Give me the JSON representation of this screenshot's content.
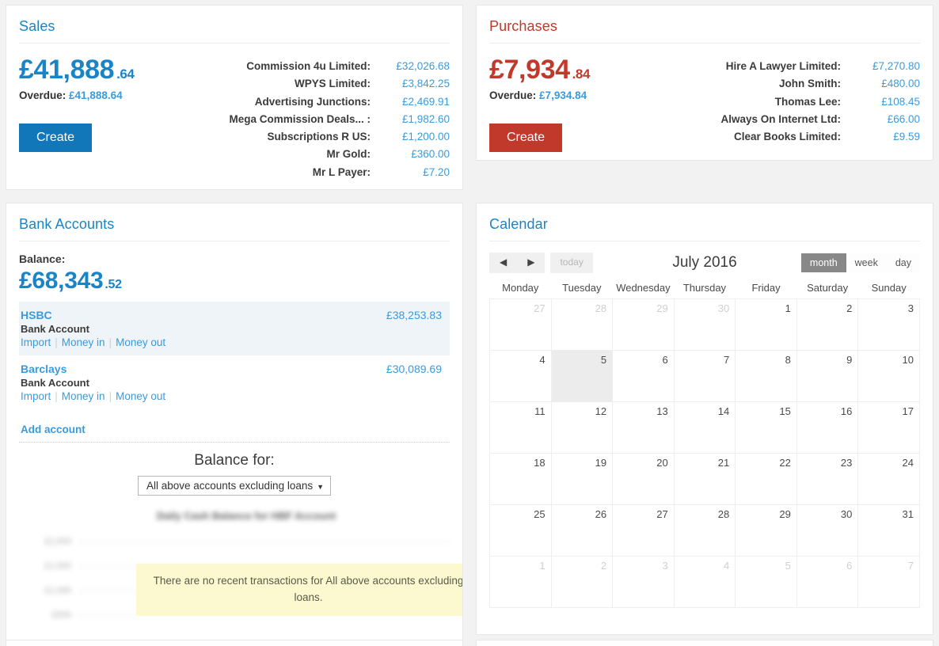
{
  "sales": {
    "title": "Sales",
    "amount_main": "£41,888",
    "amount_pence": ".64",
    "overdue_label": "Overdue:",
    "overdue_value": "£41,888.64",
    "create_label": "Create",
    "accent_color": "#1b84c7",
    "button_color": "#1277b8",
    "top_customers": [
      {
        "name": "Commission 4u Limited:",
        "amount": "£32,026.68"
      },
      {
        "name": "WPYS Limited:",
        "amount": "£3,842.25"
      },
      {
        "name": "Advertising Junctions:",
        "amount": "£2,469.91"
      },
      {
        "name": "Mega Commission Deals... :",
        "amount": "£1,982.60"
      },
      {
        "name": "Subscriptions R US:",
        "amount": "£1,200.00"
      },
      {
        "name": "Mr Gold:",
        "amount": "£360.00"
      },
      {
        "name": "Mr L Payer:",
        "amount": "£7.20"
      }
    ]
  },
  "purchases": {
    "title": "Purchases",
    "amount_main": "£7,934",
    "amount_pence": ".84",
    "overdue_label": "Overdue:",
    "overdue_value": "£7,934.84",
    "create_label": "Create",
    "accent_color": "#c0392b",
    "button_color": "#c0392b",
    "top_suppliers": [
      {
        "name": "Hire A Lawyer Limited:",
        "amount": "£7,270.80"
      },
      {
        "name": "John Smith:",
        "amount": "£480.00"
      },
      {
        "name": "Thomas Lee:",
        "amount": "£108.45"
      },
      {
        "name": "Always On Internet Ltd:",
        "amount": "£66.00"
      },
      {
        "name": "Clear Books Limited:",
        "amount": "£9.59"
      }
    ]
  },
  "bank": {
    "title": "Bank Accounts",
    "balance_label": "Balance:",
    "balance_main": "£68,343",
    "balance_pence": ".52",
    "accounts": [
      {
        "name": "HSBC",
        "type": "Bank Account",
        "amount": "£38,253.83",
        "links": [
          "Import",
          "Money in",
          "Money out"
        ]
      },
      {
        "name": "Barclays",
        "type": "Bank Account",
        "amount": "£30,089.69",
        "links": [
          "Import",
          "Money in",
          "Money out"
        ]
      }
    ],
    "add_account_label": "Add account",
    "balance_for_label": "Balance for:",
    "selected_account_filter": "All above accounts excluding loans",
    "no_transactions_message": "There are no recent transactions for All above accounts excluding loans.",
    "chart_title": "Daily Cash Balance for HBF Account"
  },
  "chart_data": {
    "type": "line",
    "title": "Daily Cash Balance for HBF Account",
    "xlabel": "",
    "ylabel": "",
    "x": [],
    "values": [],
    "note": "Chart is blurred/obscured in the screenshot; only faint horizontal gridlines and blurred y-axis tick labels are visible. No readable data points.",
    "gridlines": 4,
    "ytick_labels": [
      "",
      "",
      "",
      ""
    ]
  },
  "calendar": {
    "title": "Calendar",
    "prev_label": "◀",
    "next_label": "▶",
    "today_label": "today",
    "period_title": "July 2016",
    "views": [
      {
        "label": "month",
        "active": true
      },
      {
        "label": "week",
        "active": false
      },
      {
        "label": "day",
        "active": false
      }
    ],
    "day_headers": [
      "Monday",
      "Tuesday",
      "Wednesday",
      "Thursday",
      "Friday",
      "Saturday",
      "Sunday"
    ],
    "weeks": [
      [
        {
          "d": "27",
          "other": true
        },
        {
          "d": "28",
          "other": true
        },
        {
          "d": "29",
          "other": true
        },
        {
          "d": "30",
          "other": true
        },
        {
          "d": "1"
        },
        {
          "d": "2"
        },
        {
          "d": "3"
        }
      ],
      [
        {
          "d": "4"
        },
        {
          "d": "5",
          "today": true
        },
        {
          "d": "6"
        },
        {
          "d": "7"
        },
        {
          "d": "8"
        },
        {
          "d": "9"
        },
        {
          "d": "10"
        }
      ],
      [
        {
          "d": "11"
        },
        {
          "d": "12"
        },
        {
          "d": "13"
        },
        {
          "d": "14"
        },
        {
          "d": "15"
        },
        {
          "d": "16"
        },
        {
          "d": "17"
        }
      ],
      [
        {
          "d": "18"
        },
        {
          "d": "19"
        },
        {
          "d": "20"
        },
        {
          "d": "21"
        },
        {
          "d": "22"
        },
        {
          "d": "23"
        },
        {
          "d": "24"
        }
      ],
      [
        {
          "d": "25"
        },
        {
          "d": "26"
        },
        {
          "d": "27"
        },
        {
          "d": "28"
        },
        {
          "d": "29"
        },
        {
          "d": "30"
        },
        {
          "d": "31"
        }
      ],
      [
        {
          "d": "1",
          "other": true
        },
        {
          "d": "2",
          "other": true
        },
        {
          "d": "3",
          "other": true
        },
        {
          "d": "4",
          "other": true
        },
        {
          "d": "5",
          "other": true
        },
        {
          "d": "6",
          "other": true
        },
        {
          "d": "7",
          "other": true
        }
      ]
    ]
  }
}
